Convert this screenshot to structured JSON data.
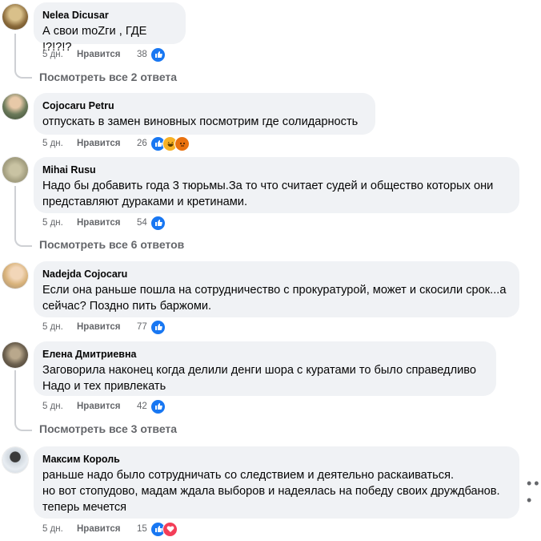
{
  "comments": [
    {
      "author": "Nelea Dicusar",
      "text": "А свои moZги , ГДЕ !?!?!?",
      "time": "5 дн.",
      "like": "Нравится",
      "count": "38",
      "reactions": [
        "like-icon"
      ],
      "reply_link": "Посмотреть все 2 ответа"
    },
    {
      "author": "Cojocaru Petru",
      "text": "отпускать в замен виновных посмотрим где солидарность",
      "time": "5 дн.",
      "like": "Нравится",
      "count": "26",
      "reactions": [
        "like-icon",
        "haha-icon",
        "angry-icon"
      ]
    },
    {
      "author": "Mihai Rusu",
      "text": "Надо бы добавить года 3 тюрьмы.За то что считает судей и общество которых они\nпредставляют дураками и кретинами.",
      "time": "5 дн.",
      "like": "Нравится",
      "count": "54",
      "reactions": [
        "like-icon"
      ],
      "reply_link": "Посмотреть все 6 ответов"
    },
    {
      "author": "Nadejda Cojocaru",
      "text": "Если она раньше пошла на сотрудничество с прокуратурой, может и скосили срок...а\nсейчас? Поздно пить баржоми.",
      "time": "5 дн.",
      "like": "Нравится",
      "count": "77",
      "reactions": [
        "like-icon"
      ]
    },
    {
      "author": "Елена Дмитриевна",
      "text": "Заговорила наконец когда делили денги шора с куратами то было справедливо\nНадо и тех привлекать",
      "time": "5 дн.",
      "like": "Нравится",
      "count": "42",
      "reactions": [
        "like-icon"
      ],
      "reply_link": "Посмотреть все 3 ответа"
    },
    {
      "author": "Максим Король",
      "text": "раньше надо было сотрудничать со следствием и деятельно раскаиваться.\nно вот стопудово, мадам ждала выборов и надеялась на победу своих друждбанов.\nтеперь мечется",
      "time": "5 дн.",
      "like": "Нравится",
      "count": "15",
      "reactions": [
        "like-icon",
        "love-icon"
      ]
    }
  ],
  "more_icon": "more-options-icon",
  "colors": {
    "bubble": "#f0f2f5",
    "secondary": "#65676b",
    "like_blue": "#1877f2",
    "love_red": "#f33e58",
    "reaction_yellow": "#f7b125",
    "angry_orange": "#e9710f",
    "thread_line": "#ced0d4"
  }
}
